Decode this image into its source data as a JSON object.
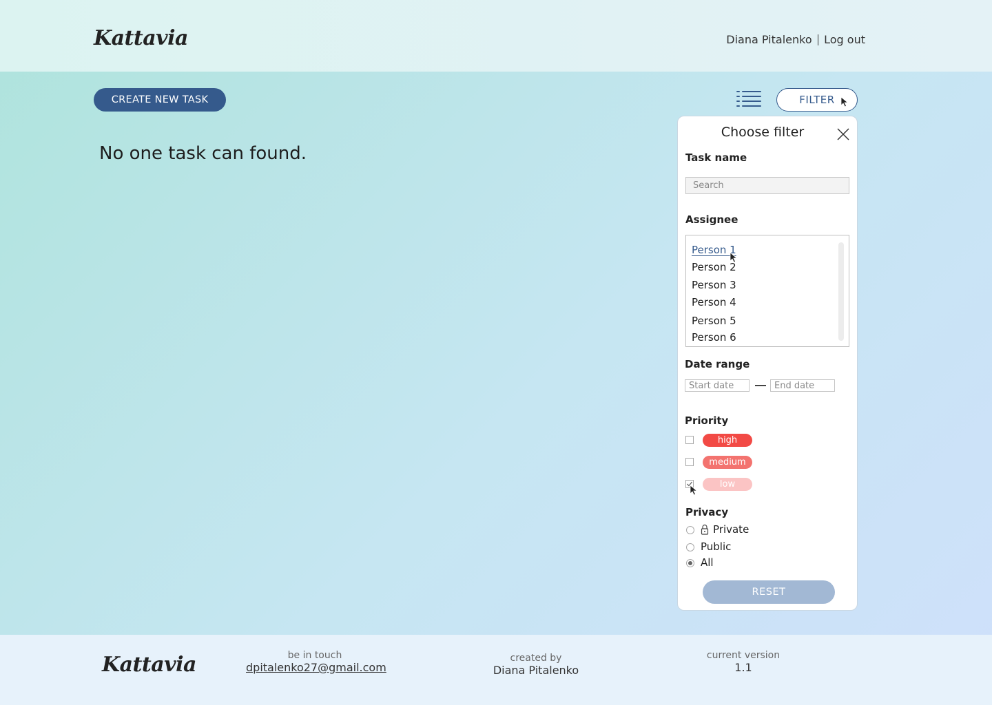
{
  "header": {
    "logo": "Kattavia",
    "user_name": "Diana Pitalenko",
    "logout_label": "Log out"
  },
  "toolbar": {
    "create_label": "CREATE NEW TASK",
    "list_icon": "list-icon",
    "filter_label": "FILTER"
  },
  "main": {
    "empty_message": "No one task can found."
  },
  "filter_panel": {
    "title": "Choose filter",
    "task_name": {
      "label": "Task name",
      "placeholder": "Search"
    },
    "assignee": {
      "label": "Assignee",
      "selected": "Person 1",
      "options": [
        "Person 1",
        "Person 2",
        "Person 3",
        "Person 4",
        "Person 5",
        "Person 6"
      ]
    },
    "date_range": {
      "label": "Date range",
      "start_placeholder": "Start date",
      "end_placeholder": "End date"
    },
    "priority": {
      "label": "Priority",
      "options": [
        {
          "label": "high",
          "checked": false,
          "color": "#f24a45"
        },
        {
          "label": "medium",
          "checked": false,
          "color": "#f3736f"
        },
        {
          "label": "low",
          "checked": true,
          "color": "#fbc4c4"
        }
      ]
    },
    "privacy": {
      "label": "Privacy",
      "options": [
        {
          "label": "Private",
          "selected": false,
          "icon": "lock-icon"
        },
        {
          "label": "Public",
          "selected": false
        },
        {
          "label": "All",
          "selected": true
        }
      ]
    },
    "reset_label": "RESET"
  },
  "footer": {
    "logo": "Kattavia",
    "contact_label": "be in touch",
    "contact_email": "dpitalenko27@gmail.com",
    "created_label": "created by",
    "created_name": "Diana Pitalenko",
    "version_label": "current version",
    "version_value": "1.1"
  },
  "colors": {
    "accent": "#355a8c",
    "reset": "#a2b8d4"
  }
}
